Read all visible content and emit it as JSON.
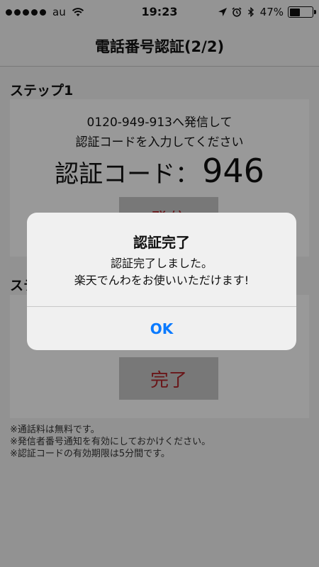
{
  "status_bar": {
    "carrier": "au",
    "time": "19:23",
    "battery_percent": "47%",
    "battery_level": 0.47,
    "icons": [
      "signal-dots-icon",
      "wifi-icon",
      "location-arrow-icon",
      "alarm-clock-icon",
      "bluetooth-icon",
      "battery-icon"
    ]
  },
  "nav": {
    "title": "電話番号認証(2/2)"
  },
  "step1": {
    "title": "ステップ1",
    "instruction_line1": "0120-949-913へ発信して",
    "instruction_line2": "認証コードを入力してください",
    "code_label": "認証コード：",
    "code_value": "946",
    "call_button": "発信"
  },
  "step2": {
    "title": "ステップ2",
    "done_button": "完了"
  },
  "notes": [
    "※通話料は無料です。",
    "※発信者番号通知を有効にしておかけください。",
    "※認証コードの有効期限は5分間です。"
  ],
  "alert": {
    "title": "認証完了",
    "message_line1": "認証完了しました。",
    "message_line2": "楽天でんわをお使いいただけます!",
    "ok_button": "OK"
  },
  "colors": {
    "accent_blue": "#0a7aff",
    "button_text_red": "#b0262a",
    "button_bg": "#c9c9c9"
  }
}
